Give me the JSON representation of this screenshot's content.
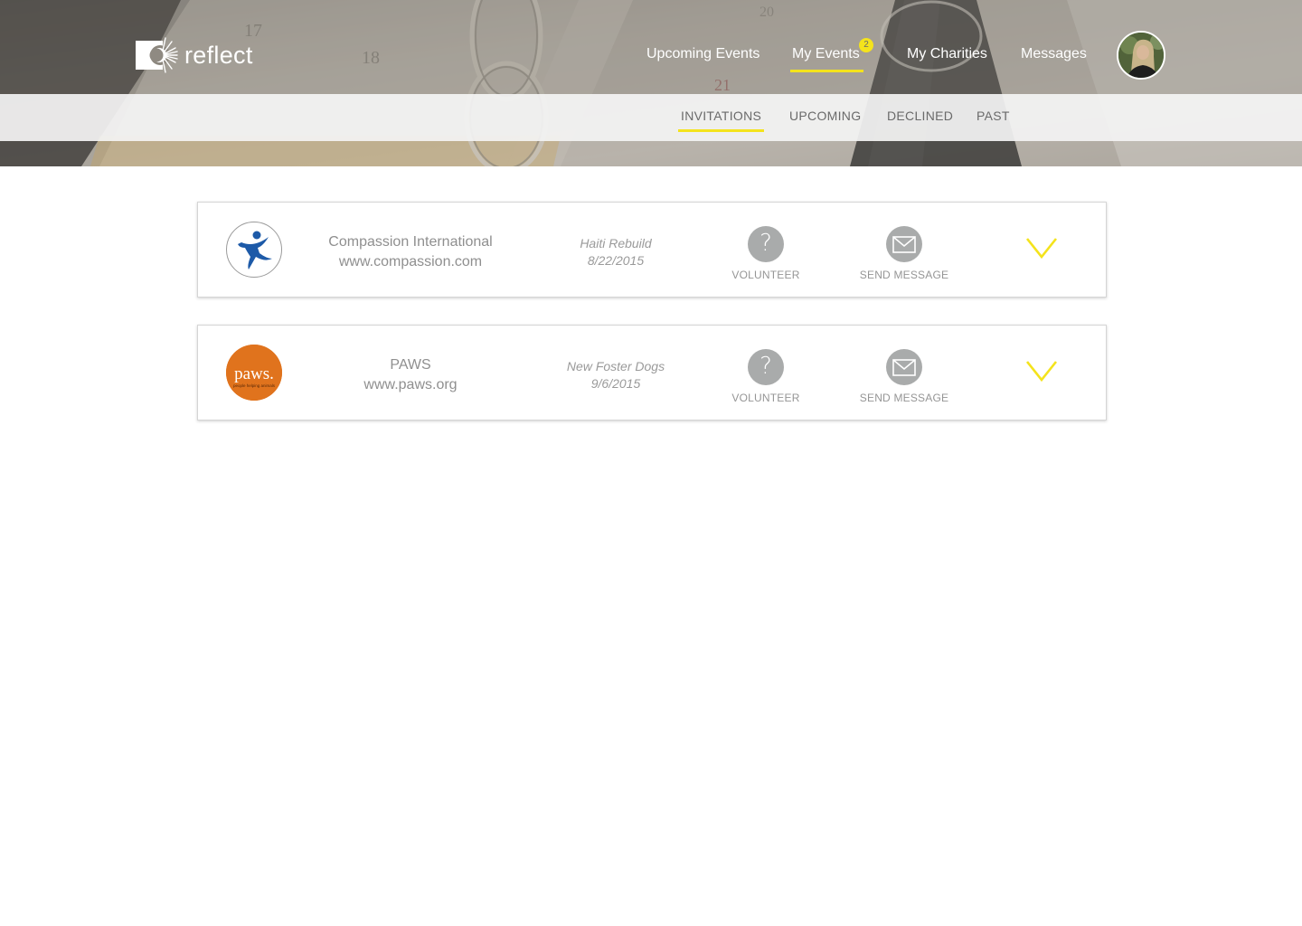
{
  "brand": {
    "name": "reflect"
  },
  "nav": {
    "items": [
      {
        "label": "Upcoming Events"
      },
      {
        "label": "My Events",
        "badge": "2"
      },
      {
        "label": "My Charities"
      },
      {
        "label": "Messages"
      }
    ],
    "active": "My Events"
  },
  "subnav": {
    "tabs": [
      {
        "label": "INVITATIONS"
      },
      {
        "label": "UPCOMING"
      },
      {
        "label": "DECLINED"
      },
      {
        "label": "PAST"
      }
    ],
    "active": "INVITATIONS"
  },
  "events": [
    {
      "org_name": "Compassion International",
      "org_url": "www.compassion.com",
      "event_name": "Haiti Rebuild",
      "event_date": "8/22/2015",
      "logo_icon": "compassion-logo",
      "actions": {
        "volunteer": "VOLUNTEER",
        "message": "SEND MESSAGE"
      }
    },
    {
      "org_name": "PAWS",
      "org_url": "www.paws.org",
      "event_name": "New Foster Dogs",
      "event_date": "9/6/2015",
      "logo_icon": "paws-logo",
      "logo_text": "paws.",
      "logo_tagline": "people helping animals",
      "actions": {
        "volunteer": "VOLUNTEER",
        "message": "SEND MESSAGE"
      }
    }
  ],
  "colors": {
    "accent": "#f4e31c",
    "action_circle": "#a9abab",
    "paws_orange": "#e0731d",
    "compassion_blue": "#1d5aa8"
  },
  "icons": {
    "volunteer": "question-icon",
    "message": "envelope-icon",
    "expand": "chevron-down-icon"
  }
}
